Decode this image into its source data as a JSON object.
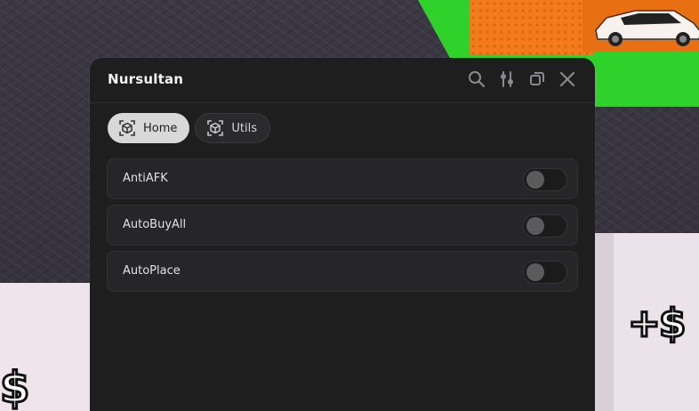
{
  "window": {
    "title": "Nursultan",
    "header_icons": [
      "search-icon",
      "sliders-icon",
      "minimize-icon",
      "close-icon"
    ]
  },
  "tabs": [
    {
      "label": "Home",
      "icon": "cube-icon",
      "active": true
    },
    {
      "label": "Utils",
      "icon": "cube-icon",
      "active": false
    }
  ],
  "toggles": [
    {
      "label": "AntiAFK",
      "on": false
    },
    {
      "label": "AutoBuyAll",
      "on": false
    },
    {
      "label": "AutoPlace",
      "on": false
    }
  ],
  "colors": {
    "panel_bg": "#1e1e1f",
    "row_bg": "#262628",
    "active_tab": "#d8d8d8",
    "scene_green": "#2fd12b",
    "scene_orange": "#f57a19"
  }
}
